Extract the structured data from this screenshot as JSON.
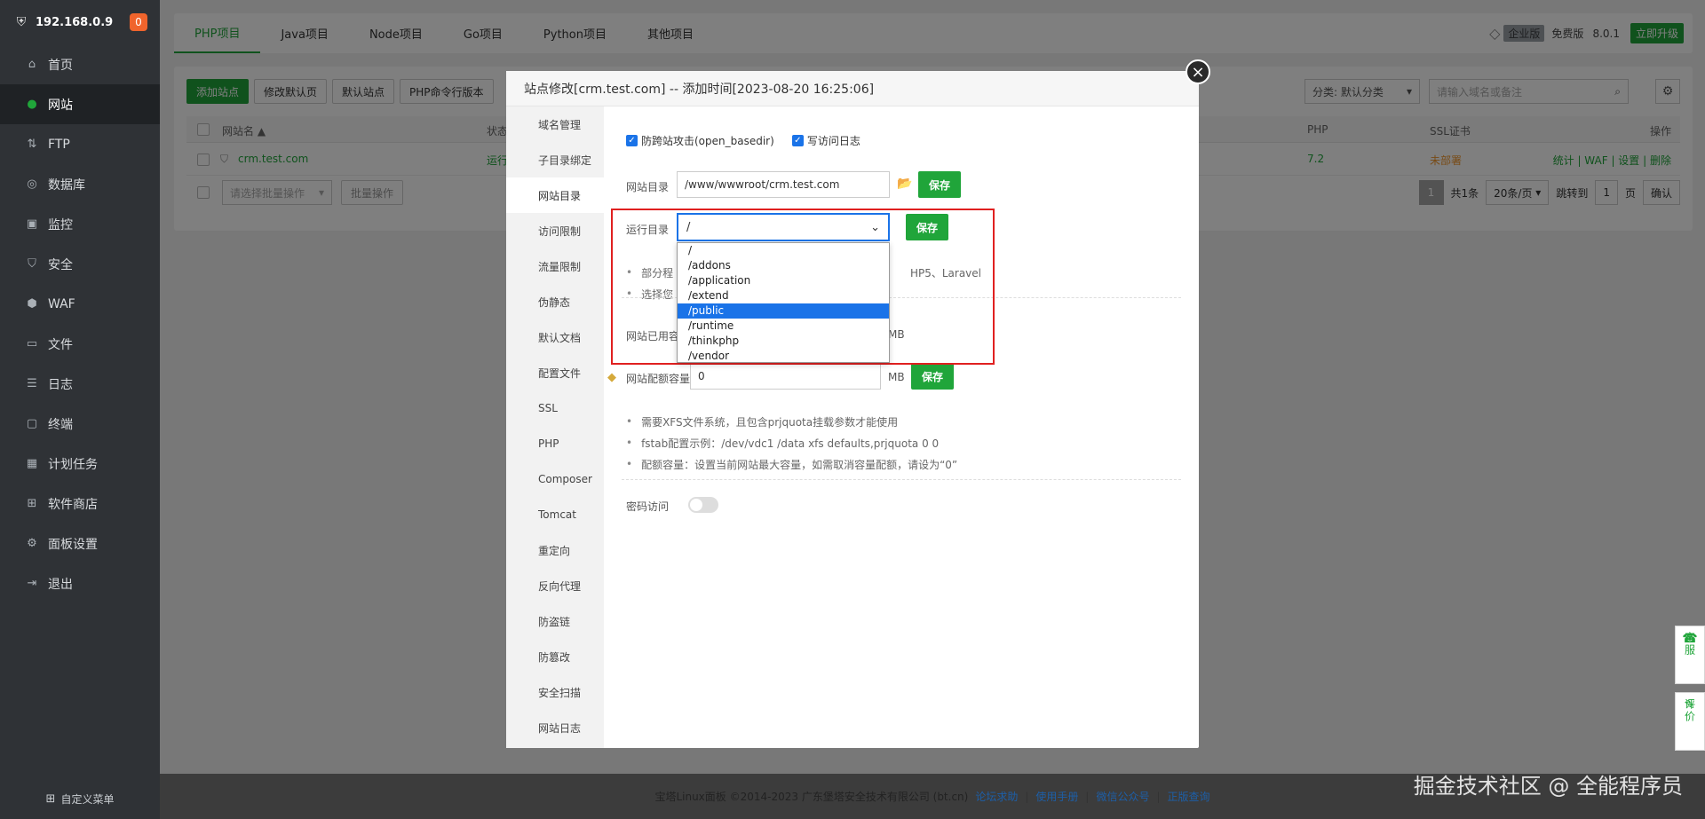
{
  "sidebar": {
    "host": "192.168.0.9",
    "badge": "0",
    "items": [
      {
        "label": "首页",
        "icon": "home-icon"
      },
      {
        "label": "网站",
        "icon": "globe-icon"
      },
      {
        "label": "FTP",
        "icon": "ftp-icon"
      },
      {
        "label": "数据库",
        "icon": "database-icon"
      },
      {
        "label": "监控",
        "icon": "monitor-icon"
      },
      {
        "label": "安全",
        "icon": "shield-icon"
      },
      {
        "label": "WAF",
        "icon": "waf-shield-icon"
      },
      {
        "label": "文件",
        "icon": "folder-icon"
      },
      {
        "label": "日志",
        "icon": "log-icon"
      },
      {
        "label": "终端",
        "icon": "terminal-icon"
      },
      {
        "label": "计划任务",
        "icon": "calendar-icon"
      },
      {
        "label": "软件商店",
        "icon": "apps-icon"
      },
      {
        "label": "面板设置",
        "icon": "gear-icon"
      },
      {
        "label": "退出",
        "icon": "logout-icon"
      }
    ],
    "custom_menu": "自定义菜单"
  },
  "topnav": {
    "tabs": [
      "PHP项目",
      "Java项目",
      "Node项目",
      "Go项目",
      "Python项目",
      "其他项目"
    ],
    "enterprise": "企业版",
    "free": "免费版",
    "version": "8.0.1",
    "upgrade": "立即升级"
  },
  "toolbar": {
    "buttons": [
      "添加站点",
      "修改默认页",
      "默认站点",
      "PHP命令行版本"
    ],
    "category": "分类: 默认分类",
    "search_placeholder": "请输入域名或备注"
  },
  "table": {
    "headers": {
      "name": "网站名 ▲",
      "status": "状态",
      "php": "PHP",
      "ssl": "SSL证书",
      "ops": "操作"
    },
    "row": {
      "name": "crm.test.com",
      "status": "运行",
      "php": "7.2",
      "ssl": "未部署",
      "ops": [
        "统计",
        "WAF",
        "设置",
        "删除"
      ]
    },
    "batch_placeholder": "请选择批量操作",
    "batch_btn": "批量操作",
    "pager": {
      "page": "1",
      "total": "共1条",
      "per": "20条/页",
      "goto": "跳转到",
      "goto_val": "1",
      "page_unit": "页",
      "confirm": "确认"
    }
  },
  "dialog": {
    "title": "站点修改[crm.test.com] -- 添加时间[2023-08-20 16:25:06]",
    "menu": [
      "域名管理",
      "子目录绑定",
      "网站目录",
      "访问限制",
      "流量限制",
      "伪静态",
      "默认文档",
      "配置文件",
      "SSL",
      "PHP",
      "Composer",
      "Tomcat",
      "重定向",
      "反向代理",
      "防盗链",
      "防篡改",
      "安全扫描",
      "网站日志"
    ],
    "active_menu": "网站目录",
    "check1": "防跨站攻击(open_basedir)",
    "check2": "写访问日志",
    "site_dir_label": "网站目录",
    "site_dir_value": "/www/wwwroot/crm.test.com",
    "save": "保存",
    "run_dir_label": "运行目录",
    "run_dir_value": "/",
    "run_dir_options": [
      "/",
      "/addons",
      "/application",
      "/extend",
      "/public",
      "/runtime",
      "/thinkphp",
      "/vendor"
    ],
    "run_dir_selected": "/public",
    "hint1_start": "部分程",
    "hint1_end": "HP5、Laravel",
    "hint2_start": "选择您",
    "used_label": "网站已用容",
    "mb": "MB",
    "quota_label": "网站配额容量",
    "quota_value": "0",
    "notes": [
      "需要XFS文件系统，且包含prjquota挂载参数才能使用",
      "fstab配置示例：/dev/vdc1 /data xfs defaults,prjquota 0 0",
      "配额容量：设置当前网站最大容量，如需取消容量配额，请设为“0”"
    ],
    "password_access": "密码访问"
  },
  "footer": {
    "copyright": "宝塔Linux面板 ©2014-2023 广东堡塔安全技术有限公司 (bt.cn)",
    "links": [
      "论坛求助",
      "使用手册",
      "微信公众号",
      "正版查询"
    ]
  },
  "float": {
    "service": "客服",
    "rate": "评价"
  },
  "watermark": "掘金技术社区 @ 全能程序员"
}
